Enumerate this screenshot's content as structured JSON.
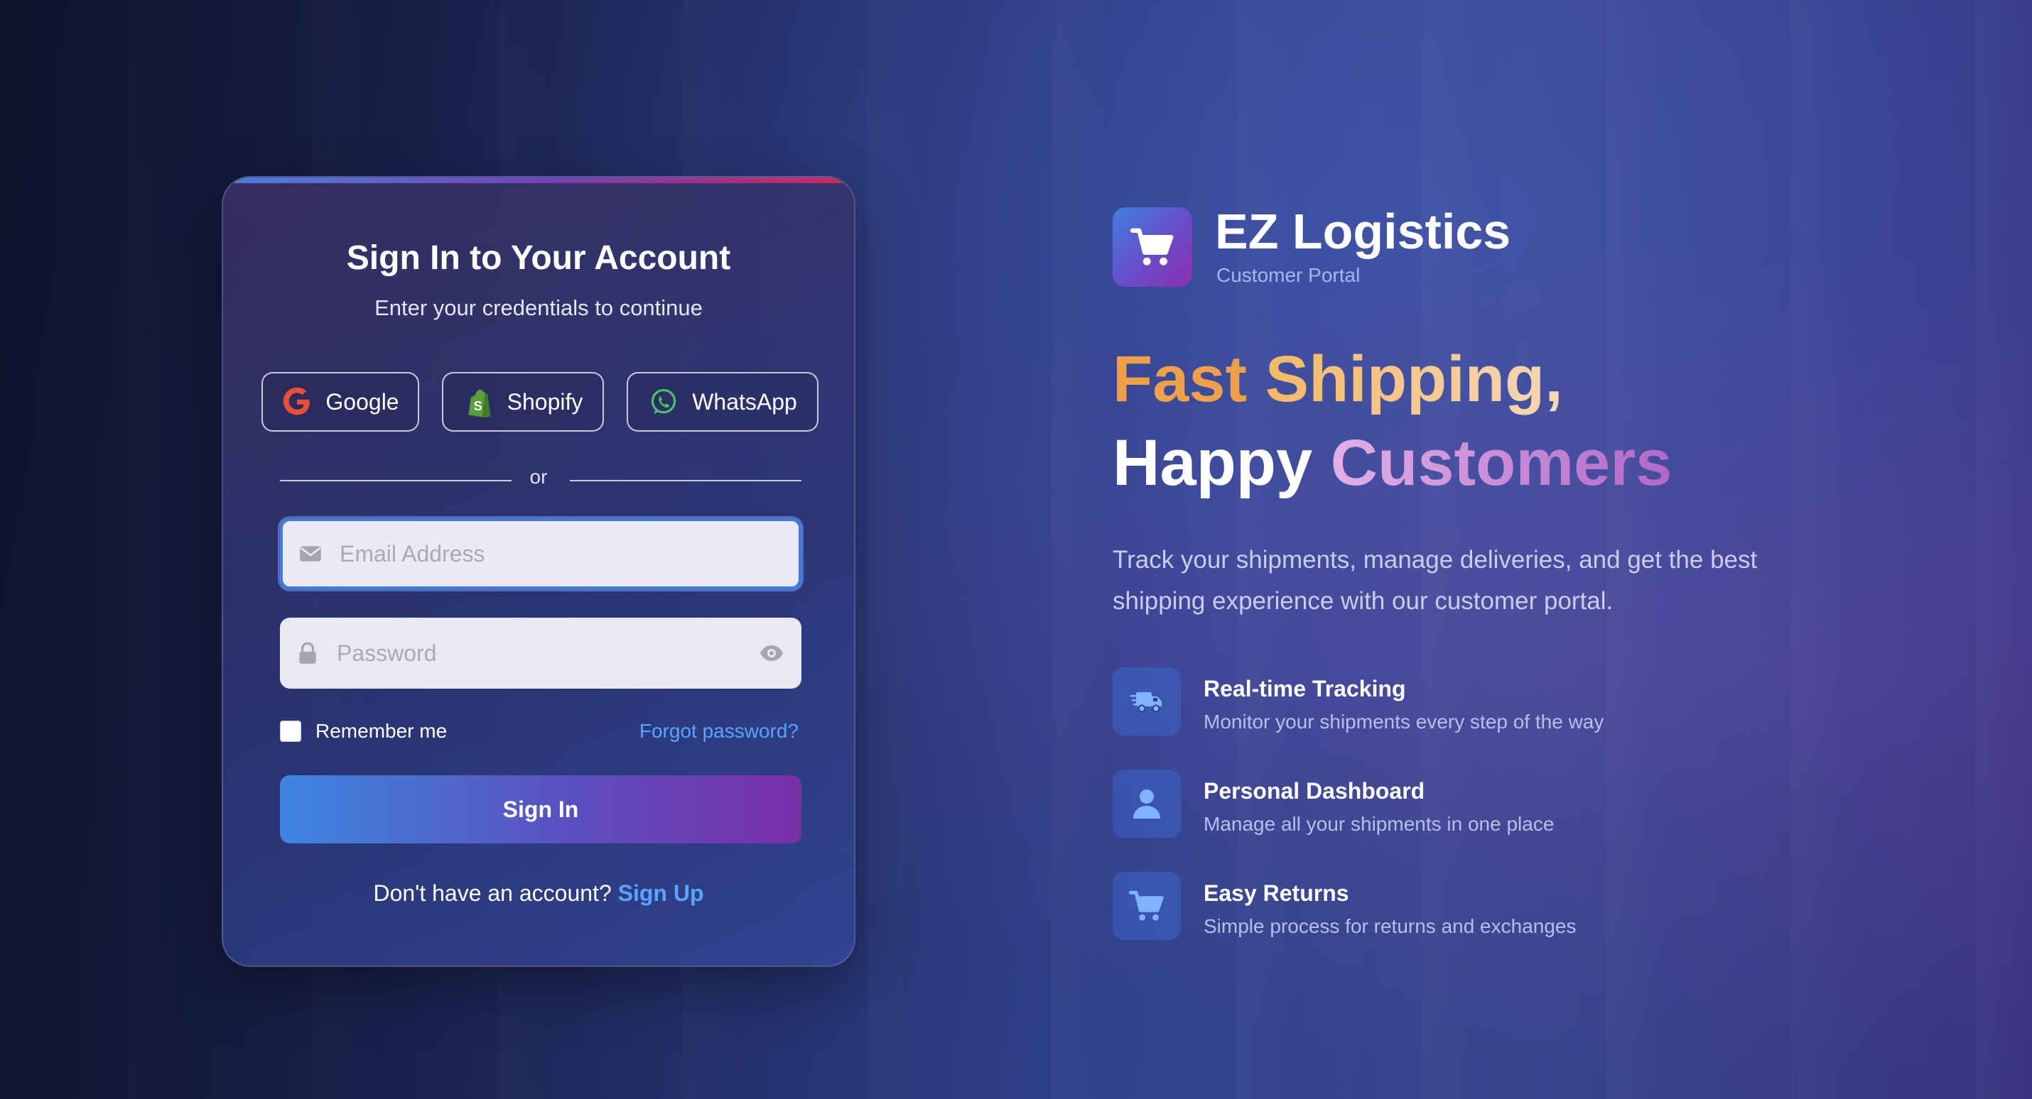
{
  "login": {
    "title": "Sign In to Your Account",
    "subtitle": "Enter your credentials to continue",
    "social": [
      {
        "label": "Google",
        "icon": "google-icon"
      },
      {
        "label": "Shopify",
        "icon": "shopify-icon"
      },
      {
        "label": "WhatsApp",
        "icon": "whatsapp-icon"
      }
    ],
    "divider": "or",
    "email": {
      "placeholder": "Email Address",
      "value": ""
    },
    "password": {
      "placeholder": "Password",
      "value": ""
    },
    "remember_label": "Remember me",
    "remember_checked": false,
    "forgot_label": "Forgot password?",
    "signin_label": "Sign In",
    "no_account_text": "Don't have an account?",
    "signup_label": "Sign Up"
  },
  "brand": {
    "name": "EZ Logistics",
    "subtitle": "Customer Portal",
    "logo_icon": "cart-icon"
  },
  "hero": {
    "line1_a": "Fast",
    "line1_b": "Shipping,",
    "line2_a": "Happy",
    "line2_b": "Customers",
    "description": "Track your shipments, manage deliveries, and get the best shipping experience with our customer portal."
  },
  "features": [
    {
      "title": "Real-time Tracking",
      "desc": "Monitor your shipments every step of the way",
      "icon": "truck-icon"
    },
    {
      "title": "Personal Dashboard",
      "desc": "Manage all your shipments in one place",
      "icon": "user-icon"
    },
    {
      "title": "Easy Returns",
      "desc": "Simple process for returns and exchanges",
      "icon": "cart-icon"
    }
  ],
  "colors": {
    "accent_link": "#5aa4ff",
    "button_gradient_start": "#3e86e0",
    "button_gradient_end": "#7a2fa8",
    "headline_orange": "#f1a04a",
    "headline_purple": "#b069c8"
  }
}
